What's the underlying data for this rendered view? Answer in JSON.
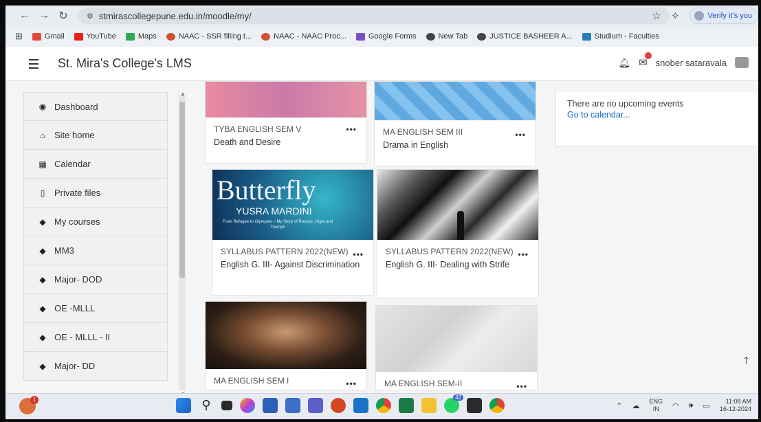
{
  "browser": {
    "url": "stmirascollegepune.edu.in/moodle/my/",
    "profile_label": "Verify it's you",
    "bookmarks": [
      "Gmail",
      "YouTube",
      "Maps",
      "NAAC - SSR filling t...",
      "NAAC - NAAC Proc...",
      "Google Forms",
      "New Tab",
      "JUSTICE BASHEER A...",
      "Studium - Faculties"
    ]
  },
  "header": {
    "site_name": "St. Mira's College's LMS",
    "user_name": "snober sataravala"
  },
  "sidebar": {
    "items": [
      {
        "label": "Dashboard",
        "icon": "dashboard-icon"
      },
      {
        "label": "Site home",
        "icon": "home-icon"
      },
      {
        "label": "Calendar",
        "icon": "calendar-icon"
      },
      {
        "label": "Private files",
        "icon": "file-icon"
      },
      {
        "label": "My courses",
        "icon": "graduation-cap-icon"
      },
      {
        "label": "MM3",
        "icon": "graduation-cap-icon"
      },
      {
        "label": "Major- DOD",
        "icon": "graduation-cap-icon"
      },
      {
        "label": "OE -MLLL",
        "icon": "graduation-cap-icon"
      },
      {
        "label": "OE - MLLL - II",
        "icon": "graduation-cap-icon"
      },
      {
        "label": "Major- DD",
        "icon": "graduation-cap-icon"
      }
    ]
  },
  "courses": [
    {
      "category": "TYBA ENGLISH SEM V",
      "name": "Death and Desire",
      "menu": "•••"
    },
    {
      "category": "MA ENGLISH SEM III",
      "name": "Drama in English",
      "menu": "•••"
    },
    {
      "category": "SYLLABUS PATTERN 2022(NEW)",
      "name": "English G. III- Against Discrimination",
      "menu": "•••",
      "image_title": "Butterfly",
      "image_author": "YUSRA MARDINI",
      "image_subtitle": "From Refugee to Olympian – My Story of Rescue, Hope and Triumph"
    },
    {
      "category": "SYLLABUS PATTERN 2022(NEW)",
      "name": "English G. III- Dealing with Strife",
      "menu": "•••"
    },
    {
      "category": "MA ENGLISH SEM I",
      "name": "",
      "menu": "•••"
    },
    {
      "category": "MA ENGLISH SEM-II",
      "name": "",
      "menu": "•••"
    }
  ],
  "events": {
    "empty_text": "There are no upcoming events",
    "calendar_link": "Go to calendar..."
  },
  "taskbar": {
    "notification_count": "1",
    "whatsapp_badge": "42",
    "language_top": "ENG",
    "language_bottom": "IN",
    "time": "11:08 AM",
    "date": "16-12-2024"
  }
}
